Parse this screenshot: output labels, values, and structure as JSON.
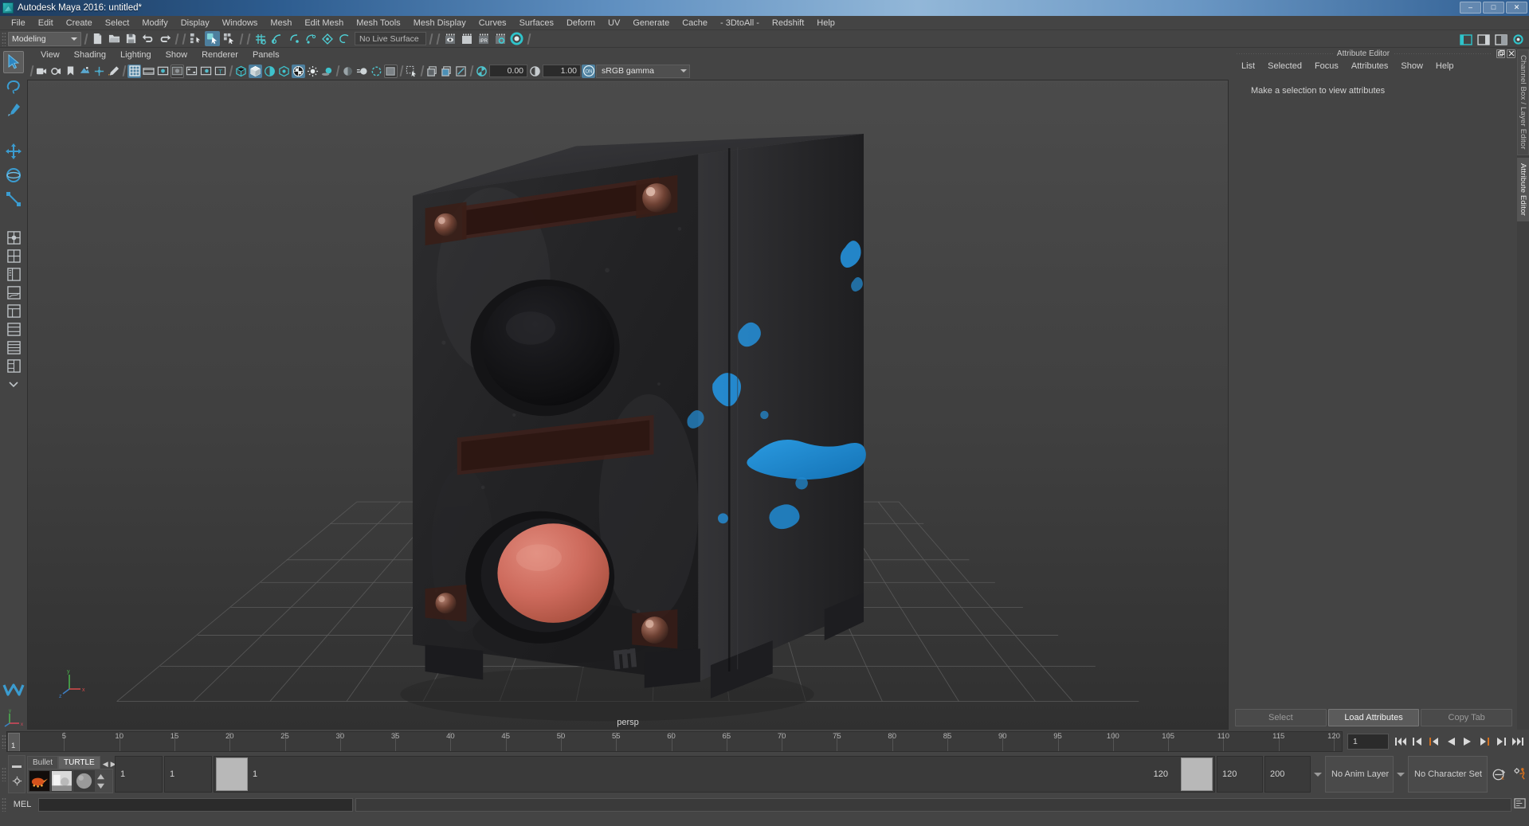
{
  "window": {
    "title": "Autodesk Maya 2016: untitled*",
    "app_icon": "maya-logo-icon",
    "controls": {
      "minimize": "–",
      "maximize": "□",
      "close": "✕"
    }
  },
  "menubar": {
    "items": [
      "File",
      "Edit",
      "Create",
      "Select",
      "Modify",
      "Display",
      "Windows",
      "Mesh",
      "Edit Mesh",
      "Mesh Tools",
      "Mesh Display",
      "Curves",
      "Surfaces",
      "Deform",
      "UV",
      "Generate",
      "Cache",
      "- 3DtoAll -",
      "Redshift",
      "Help"
    ]
  },
  "statusbar": {
    "menuset": "Modeling",
    "live_surface": "No Live Surface",
    "icons": [
      "new-scene-icon",
      "open-scene-icon",
      "save-scene-icon",
      "undo-icon",
      "redo-icon",
      "select-by-hierarchy-icon",
      "select-by-object-icon",
      "select-by-component-icon",
      "snap-to-grid-icon",
      "snap-to-curve-icon",
      "snap-to-point-icon",
      "snap-to-projected-center-icon",
      "snap-to-view-plane-icon",
      "make-live-icon",
      "render-view-icon",
      "render-sequence-icon",
      "ipr-render-icon",
      "render-settings-icon",
      "hypershade-icon"
    ],
    "right_icons": [
      "show-hide-ui-icon",
      "channel-box-toggle-icon",
      "attribute-editor-toggle-icon",
      "tool-settings-icon"
    ]
  },
  "toolbox": {
    "tools": [
      {
        "name": "select-tool",
        "icon": "arrow-cursor-icon",
        "active": true
      },
      {
        "name": "lasso-tool",
        "icon": "lasso-icon",
        "active": false
      },
      {
        "name": "paint-select-tool",
        "icon": "paint-brush-icon",
        "active": false
      },
      {
        "name": "move-tool",
        "icon": "move-arrows-icon",
        "active": false
      },
      {
        "name": "rotate-tool",
        "icon": "rotate-ring-icon",
        "active": false
      },
      {
        "name": "scale-tool",
        "icon": "scale-box-icon",
        "active": false
      }
    ],
    "layout_tools": [
      "single-perspective-layout-icon",
      "four-view-layout-icon",
      "outliner-persp-layout-icon",
      "persp-graph-layout-icon",
      "hypershade-persp-layout-icon",
      "persp-layout-icon",
      "two-pane-layout-icon",
      "three-pane-layout-icon",
      "more-layouts-icon"
    ]
  },
  "viewport": {
    "panel_menu": [
      "View",
      "Shading",
      "Lighting",
      "Show",
      "Renderer",
      "Panels"
    ],
    "camera_label": "persp",
    "toolbar": {
      "exposure_value": "0.00",
      "gamma_value": "1.00",
      "color_management": "sRGB gamma",
      "cm_toggle": "ON",
      "icons": [
        "select-camera-icon",
        "camera-attributes-icon",
        "bookmark-icon",
        "image-plane-icon",
        "two-d-pan-zoom-icon",
        "grease-pencil-icon",
        "grid-toggle-icon",
        "film-gate-icon",
        "resolution-gate-icon",
        "gate-mask-icon",
        "film-origin-icon",
        "safe-action-icon",
        "title-safe-icon",
        "wireframe-icon",
        "smooth-shade-icon",
        "shaded-wireframe-icon",
        "hardware-texture-icon",
        "checker-texture-icon",
        "use-lights-icon",
        "shadows-icon",
        "screen-space-ao-icon",
        "motion-blur-icon",
        "multisample-icon",
        "depth-of-field-icon",
        "isolate-select-icon",
        "xray-icon",
        "xray-joints-icon",
        "xray-active-components-icon",
        "exposure-icon",
        "gamma-icon",
        "color-management-toggle-icon"
      ]
    },
    "axis_indicator": {
      "x": "x",
      "y": "y",
      "z": "z"
    }
  },
  "attribute_editor": {
    "panel_title": "Attribute Editor",
    "menus": [
      "List",
      "Selected",
      "Focus",
      "Attributes",
      "Show",
      "Help"
    ],
    "empty_message": "Make a selection to view attributes",
    "buttons": [
      {
        "label": "Select",
        "enabled": false
      },
      {
        "label": "Load Attributes",
        "enabled": true
      },
      {
        "label": "Copy Tab",
        "enabled": false
      }
    ],
    "window_buttons": [
      "undock-icon",
      "close-icon"
    ]
  },
  "right_tabs": [
    {
      "label": "Channel Box / Layer Editor",
      "active": false
    },
    {
      "label": "Attribute Editor",
      "active": true
    }
  ],
  "timeslider": {
    "current_frame": "1",
    "frame_field_value": "1",
    "ticks": [
      5,
      10,
      15,
      20,
      25,
      30,
      35,
      40,
      45,
      50,
      55,
      60,
      65,
      70,
      75,
      80,
      85,
      90,
      95,
      100,
      105,
      110,
      115,
      120
    ],
    "start": 1,
    "end": 120,
    "playback_buttons": [
      "go-to-start-icon",
      "step-back-frame-icon",
      "step-back-key-icon",
      "play-backwards-icon",
      "play-forwards-icon",
      "step-forward-key-icon",
      "step-forward-frame-icon",
      "go-to-end-icon"
    ]
  },
  "rangeslider": {
    "anim_start": "1",
    "anim_end": "1",
    "range_start": "1",
    "range_end": "120",
    "playback_end": "120",
    "anim_total_end": "200",
    "anim_layer": "No Anim Layer",
    "character_set": "No Character Set",
    "auto_key_icon": "auto-key-icon",
    "animation_prefs_icon": "animation-preferences-icon"
  },
  "shelf": {
    "tabs": [
      "Bullet",
      "TURTLE"
    ],
    "active_tab": "TURTLE",
    "nav_left": "◀",
    "nav_right": "▶",
    "swatches": [
      "turtle-render-icon",
      "turtle-bake-icon",
      "turtle-material-icon"
    ]
  },
  "commandline": {
    "language": "MEL",
    "input_value": "",
    "output_value": ""
  },
  "colors": {
    "accent_blue": "#4d7f9e",
    "panel_bg": "#444444",
    "dark_bg": "#2b2b2b",
    "viewport_bg": "#3c3c3c",
    "text": "#d2d2d2",
    "title_blue": "#5f8fc0",
    "orange": "#d3701f",
    "teal": "#34b5b8"
  }
}
